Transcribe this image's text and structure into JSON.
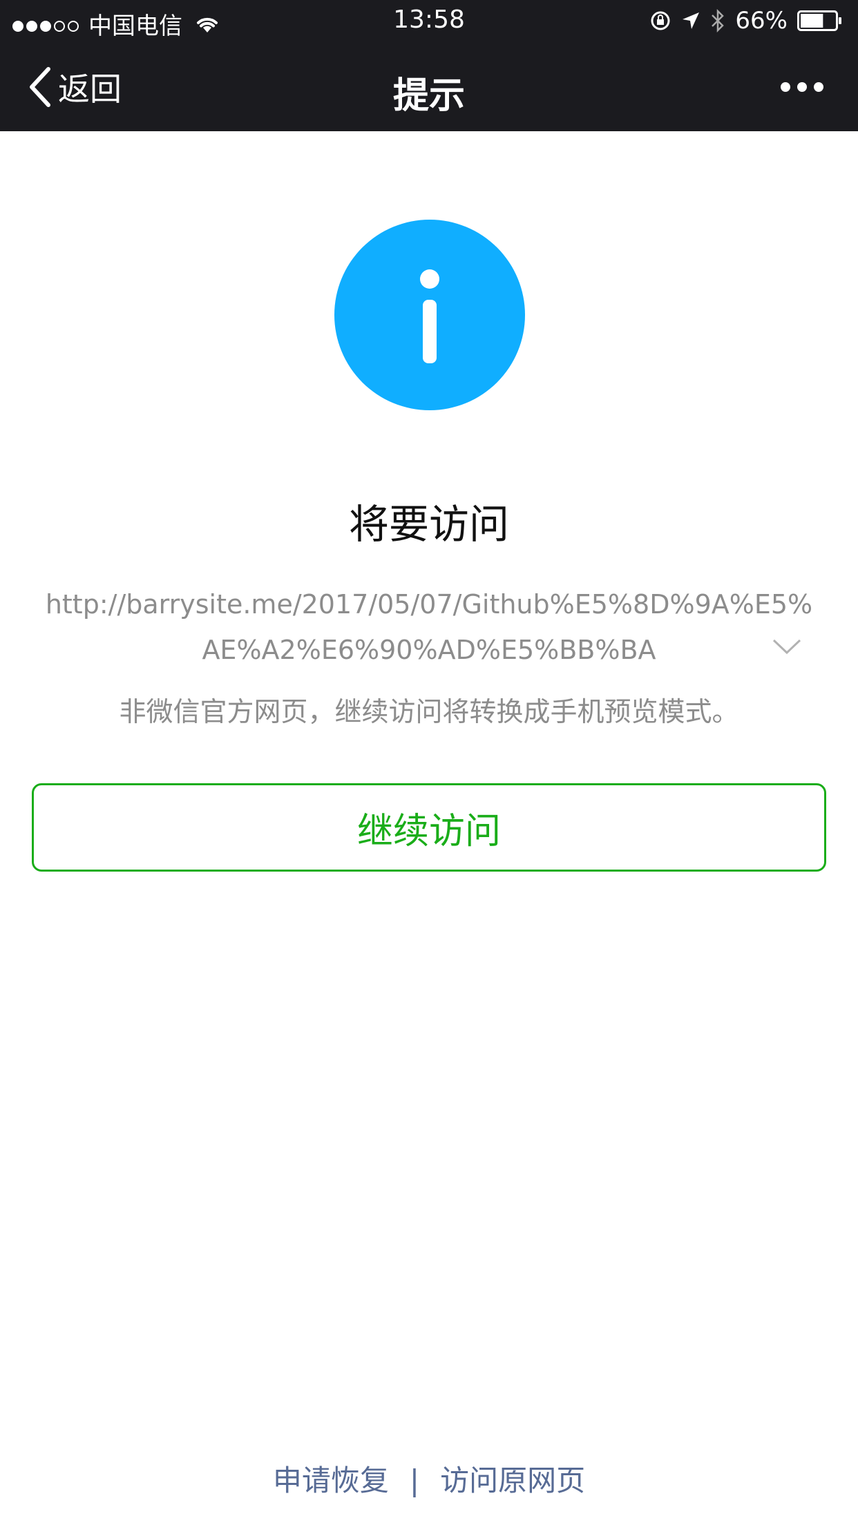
{
  "status_bar": {
    "carrier": "中国电信",
    "time": "13:58",
    "battery_percent": "66%",
    "battery_level": 0.66,
    "signal_bars_filled": 3,
    "signal_bars_total": 5
  },
  "nav": {
    "back_label": "返回",
    "title": "提示"
  },
  "content": {
    "icon": "info-icon",
    "icon_color": "#10aeff",
    "heading": "将要访问",
    "url": "http://barrysite.me/2017/05/07/Github%E5%8D%9A%E5%AE%A2%E6%90%AD%E5%BB%BA",
    "notice": "非微信官方网页，继续访问将转换成手机预览模式。"
  },
  "actions": {
    "continue_label": "继续访问",
    "accent_color": "#1aad19"
  },
  "footer": {
    "appeal_label": "申请恢复",
    "separator": "|",
    "original_label": "访问原网页",
    "link_color": "#576b95"
  }
}
